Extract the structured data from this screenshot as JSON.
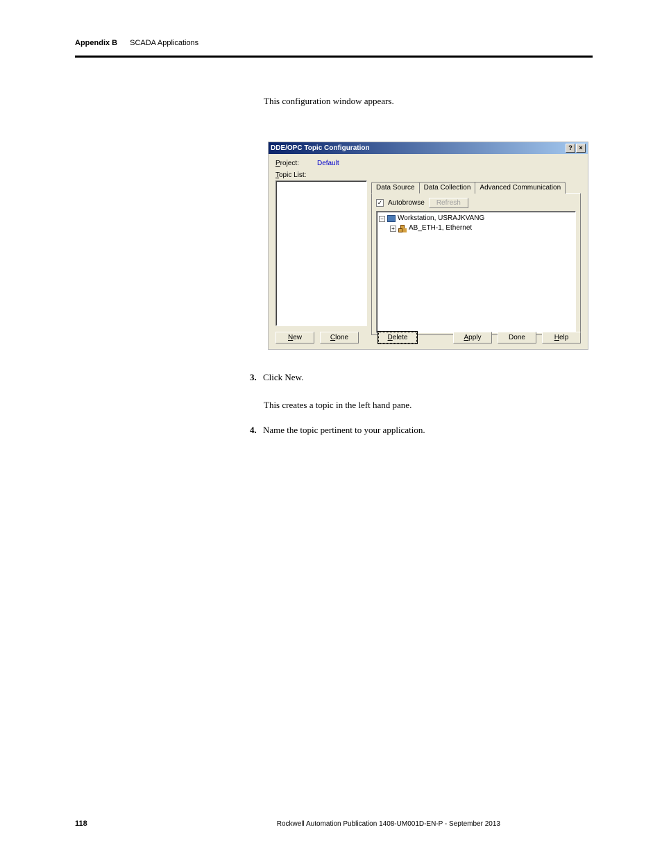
{
  "header": {
    "appendix": "Appendix B",
    "title": "SCADA Applications"
  },
  "intro": "This configuration window appears.",
  "dialog": {
    "title": "DDE/OPC Topic Configuration",
    "help_btn": "?",
    "close_btn": "×",
    "project_label": "Project:",
    "project_value": "Default",
    "topic_list_label": "Topic List:",
    "tabs": {
      "data_source": "Data Source",
      "data_collection": "Data Collection",
      "advanced": "Advanced Communication"
    },
    "autobrowse": "Autobrowse",
    "refresh": "Refresh",
    "tree": {
      "workstation": "Workstation, USRAJKVANG",
      "ethernet": "AB_ETH-1, Ethernet"
    },
    "buttons": {
      "new": "New",
      "clone": "Clone",
      "delete": "Delete",
      "apply": "Apply",
      "done": "Done",
      "help": "Help"
    }
  },
  "steps": {
    "s3_num": "3.",
    "s3": "Click New.",
    "s3_sub": "This creates a topic in the left hand pane.",
    "s4_num": "4.",
    "s4": "Name the topic pertinent to your application."
  },
  "footer": {
    "page": "118",
    "pub": "Rockwell Automation Publication 1408-UM001D-EN-P - September 2013"
  }
}
